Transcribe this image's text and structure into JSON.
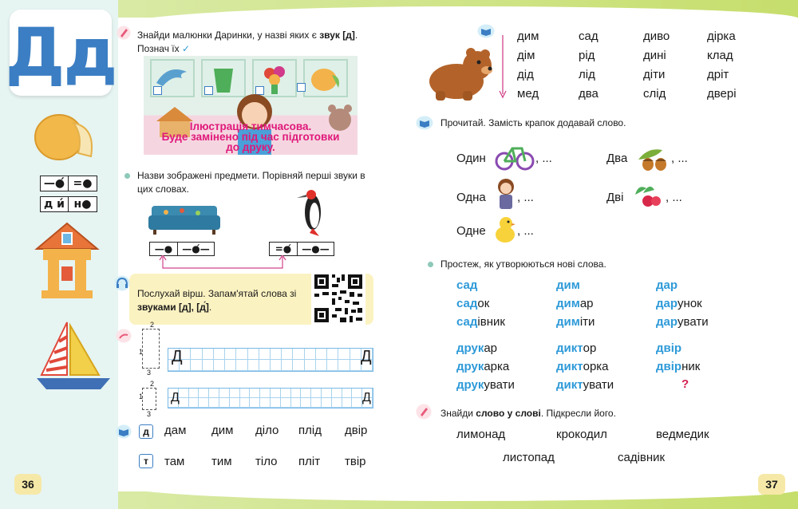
{
  "left_margin": {
    "letter": "Дд",
    "schemes": [
      [
        "—●́",
        "=●"
      ],
      [
        "д и́",
        "н●"
      ]
    ],
    "page_number": "36"
  },
  "task1": {
    "text_a": "Знайди малюнки Даринки, у назві яких є ",
    "bold": "звук [д]",
    "text_b": ".",
    "text_line2": "Познач їх",
    "check_mark": "✓",
    "watermark": [
      "Ілюстрація тимчасова.",
      "Буде замінено під час підготовки",
      "до друку."
    ]
  },
  "task2": {
    "text": "Назви зображені предмети. Порівняй перші звуки в цих словах.",
    "scheme_left": [
      "—●",
      "—●́—"
    ],
    "scheme_right": [
      "=●́",
      "—●—"
    ]
  },
  "task3": {
    "text_a": "Послухай вірш. Запам'ятай слова зі",
    "bold": "звуками [д], [д́]",
    "text_b": "."
  },
  "writing": {
    "row1_letter": "Д",
    "row1_end": "Д",
    "row2_letter": "Д",
    "row2_end": "Д",
    "guide_numbers": [
      "2",
      "1",
      "3"
    ]
  },
  "word_rows": {
    "d": {
      "tag": "д",
      "words": [
        "дам",
        "дим",
        "діло",
        "плід",
        "двір"
      ]
    },
    "t": {
      "tag": "т",
      "words": [
        "там",
        "тим",
        "тіло",
        "пліт",
        "твір"
      ]
    }
  },
  "right_top_words": [
    [
      "дим",
      "сад",
      "диво",
      "дірка"
    ],
    [
      "дім",
      "рід",
      "дині",
      "клад"
    ],
    [
      "дід",
      "лід",
      "діти",
      "дріт"
    ],
    [
      "мед",
      "два",
      "слід",
      "двері"
    ]
  ],
  "task_read": {
    "text": "Прочитай. Замість крапок додавай слово.",
    "items": [
      {
        "word": "Один",
        "tail": ", ..."
      },
      {
        "word": "Два",
        "tail": ", ..."
      },
      {
        "word": "Одна",
        "tail": ", ..."
      },
      {
        "word": "Дві",
        "tail": ", ..."
      },
      {
        "word": "Одне",
        "tail": ", ..."
      }
    ]
  },
  "task_trace": {
    "text": "Простеж, як утворюються нові слова.",
    "columns": [
      [
        [
          "сад",
          ""
        ],
        [
          "сад",
          "ок"
        ],
        [
          "сад",
          "івник"
        ]
      ],
      [
        [
          "дим",
          ""
        ],
        [
          "дим",
          "ар"
        ],
        [
          "дим",
          "іти"
        ]
      ],
      [
        [
          "дар",
          ""
        ],
        [
          "дар",
          "унок"
        ],
        [
          "дар",
          "увати"
        ]
      ]
    ],
    "columns2": [
      [
        [
          "друк",
          "ар"
        ],
        [
          "друк",
          "арка"
        ],
        [
          "друк",
          "увати"
        ]
      ],
      [
        [
          "дикт",
          "ор"
        ],
        [
          "дикт",
          "орка"
        ],
        [
          "дикт",
          "увати"
        ]
      ],
      [
        [
          "двір",
          ""
        ],
        [
          "двір",
          "ник"
        ],
        [
          "?",
          ""
        ]
      ]
    ]
  },
  "task_find": {
    "text_a": "Знайди ",
    "bold": "слово у слові",
    "text_b": ". Підкресли його.",
    "words_row1": [
      "лимонад",
      "крокодил",
      "ведмедик"
    ],
    "words_row2": [
      "листопад",
      "садівник"
    ]
  },
  "right_page_number": "37",
  "colors": {
    "accent": "#3b7ec3",
    "highlight": "#2e9ad8",
    "question": "#d21f4f",
    "watermark": "#e0187a"
  }
}
